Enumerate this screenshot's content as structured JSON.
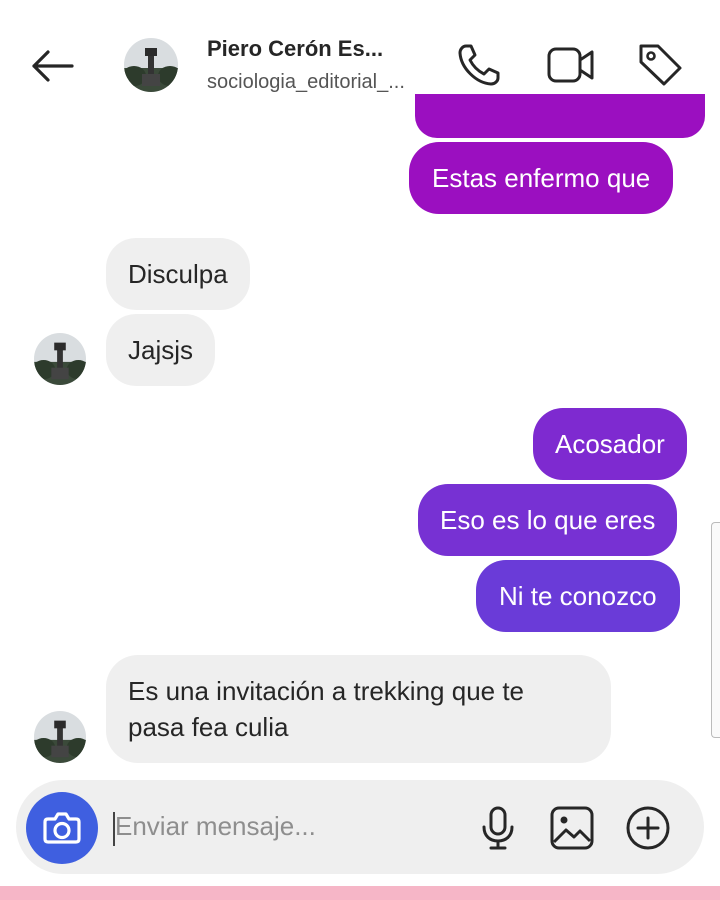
{
  "header": {
    "name": "Piero Cerón Es...",
    "username": "sociologia_editorial_..."
  },
  "messages": {
    "m1": "Estas enfermo que",
    "m2": "Disculpa",
    "m3": "Jajsjs",
    "m4": "Acosador",
    "m5": "Eso es lo que eres",
    "m6": "Ni te conozco",
    "m7_line1": "Es una invitación a trekking que te",
    "m7_line2": "pasa fea culia"
  },
  "composer": {
    "placeholder": "Enviar mensaje..."
  },
  "colors": {
    "outgoing_top": "#9b0fc0",
    "outgoing_bottom": "#6a3bd8",
    "incoming": "#efefef",
    "camera": "#3f5fe0"
  }
}
